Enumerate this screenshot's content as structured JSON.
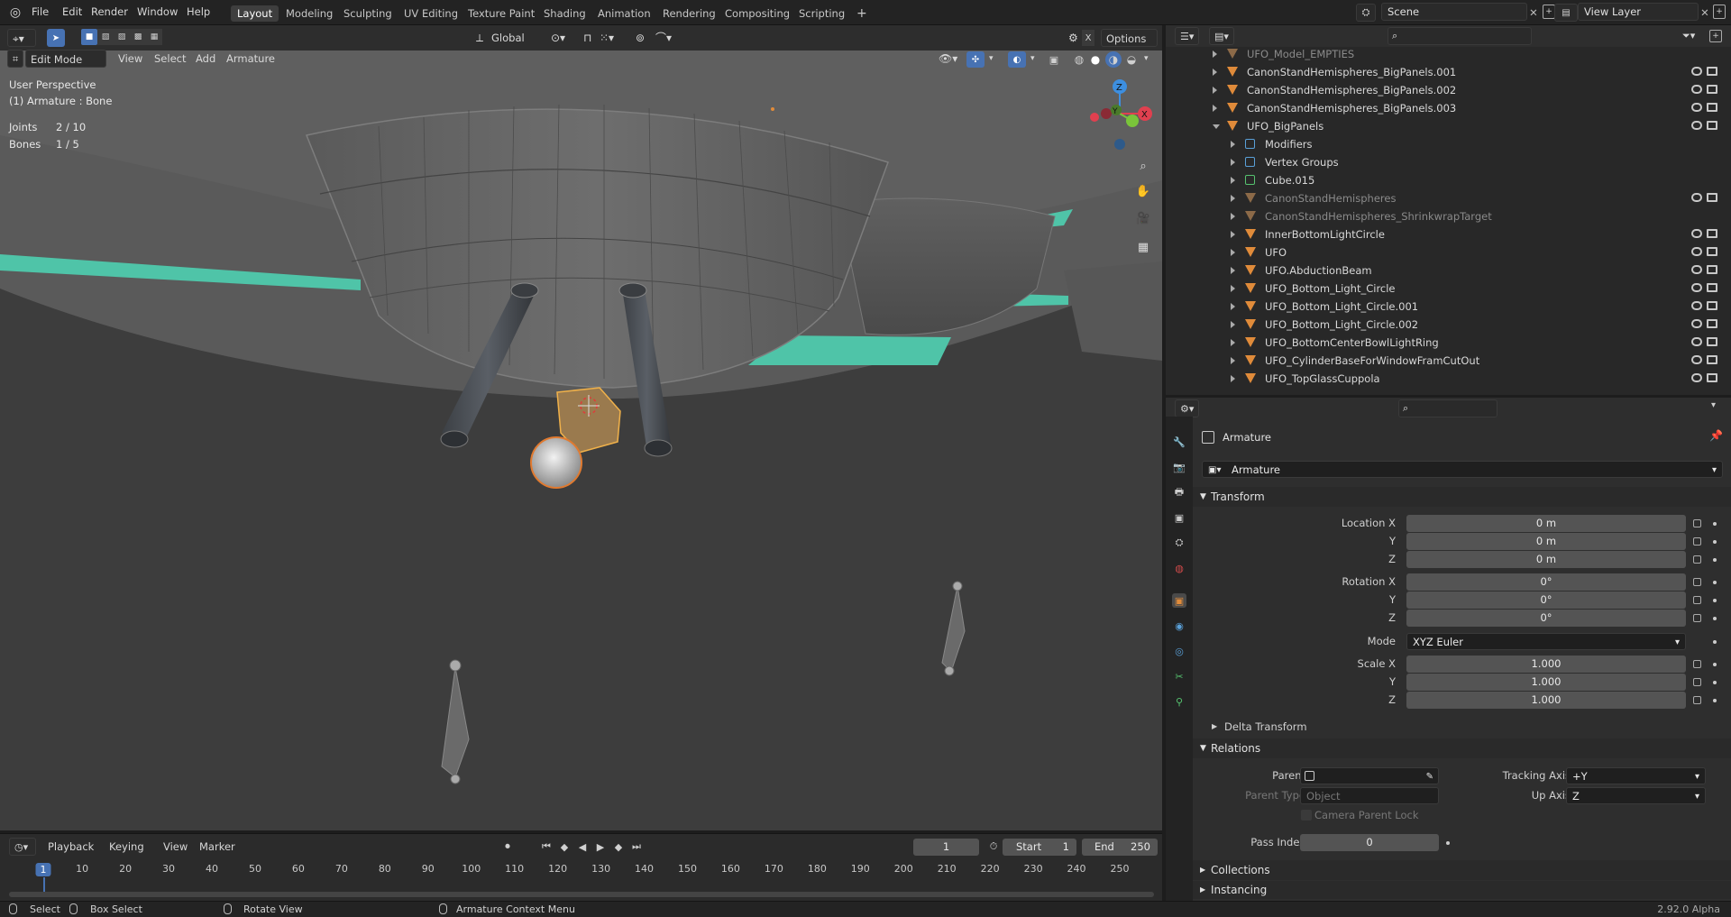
{
  "topbar": {
    "menus": [
      "File",
      "Edit",
      "Render",
      "Window",
      "Help"
    ],
    "workspaces": [
      "Layout",
      "Modeling",
      "Sculpting",
      "UV Editing",
      "Texture Paint",
      "Shading",
      "Animation",
      "Rendering",
      "Compositing",
      "Scripting"
    ],
    "active_workspace": "Layout",
    "add_tab": "+",
    "scene": "Scene",
    "view_layer": "View Layer"
  },
  "viewport_header": {
    "mode": "Edit Mode",
    "menus": [
      "View",
      "Select",
      "Add",
      "Armature"
    ],
    "orientation": "Global",
    "options": "Options"
  },
  "viewport": {
    "perspective": "User Perspective",
    "object_info": "(1) Armature : Bone",
    "stats": [
      {
        "label": "Joints",
        "value": "2 / 10"
      },
      {
        "label": "Bones",
        "value": "1 / 5"
      }
    ],
    "gizmo": {
      "x": "X",
      "y": "Y",
      "z": "Z"
    }
  },
  "timeline": {
    "menus": [
      "Playback",
      "Keying",
      "View",
      "Marker"
    ],
    "current_frame": "1",
    "start_label": "Start",
    "start": "1",
    "end_label": "End",
    "end": "250",
    "ticks": [
      "1",
      "10",
      "20",
      "30",
      "40",
      "50",
      "60",
      "70",
      "80",
      "90",
      "100",
      "110",
      "120",
      "130",
      "140",
      "150",
      "160",
      "170",
      "180",
      "190",
      "200",
      "210",
      "220",
      "230",
      "240",
      "250"
    ]
  },
  "status": {
    "select": "Select",
    "box_select": "Box Select",
    "rotate_view": "Rotate View",
    "context_menu": "Armature Context Menu",
    "version": "2.92.0 Alpha"
  },
  "outliner": {
    "rows": [
      {
        "name": "UFO_Model_EMPTIES",
        "indent": 0,
        "dim": true,
        "open": false,
        "vis": false
      },
      {
        "name": "CanonStandHemispheres_BigPanels.001",
        "indent": 0,
        "dim": false,
        "open": false,
        "vis": true
      },
      {
        "name": "CanonStandHemispheres_BigPanels.002",
        "indent": 0,
        "dim": false,
        "open": false,
        "vis": true
      },
      {
        "name": "CanonStandHemispheres_BigPanels.003",
        "indent": 0,
        "dim": false,
        "open": false,
        "vis": true
      },
      {
        "name": "UFO_BigPanels",
        "indent": 0,
        "dim": false,
        "open": true,
        "vis": true
      },
      {
        "name": "Modifiers",
        "indent": 1,
        "dim": false,
        "open": false,
        "vis": false
      },
      {
        "name": "Vertex Groups",
        "indent": 1,
        "dim": false,
        "open": false,
        "vis": false
      },
      {
        "name": "Cube.015",
        "indent": 1,
        "dim": false,
        "open": false,
        "vis": false
      },
      {
        "name": "CanonStandHemispheres",
        "indent": 1,
        "dim": true,
        "open": false,
        "vis": true
      },
      {
        "name": "CanonStandHemispheres_ShrinkwrapTarget",
        "indent": 1,
        "dim": true,
        "open": false,
        "vis": false
      },
      {
        "name": "InnerBottomLightCircle",
        "indent": 1,
        "dim": false,
        "open": false,
        "vis": true
      },
      {
        "name": "UFO",
        "indent": 1,
        "dim": false,
        "open": false,
        "vis": true
      },
      {
        "name": "UFO.AbductionBeam",
        "indent": 1,
        "dim": false,
        "open": false,
        "vis": true
      },
      {
        "name": "UFO_Bottom_Light_Circle",
        "indent": 1,
        "dim": false,
        "open": false,
        "vis": true
      },
      {
        "name": "UFO_Bottom_Light_Circle.001",
        "indent": 1,
        "dim": false,
        "open": false,
        "vis": true
      },
      {
        "name": "UFO_Bottom_Light_Circle.002",
        "indent": 1,
        "dim": false,
        "open": false,
        "vis": true
      },
      {
        "name": "UFO_BottomCenterBowlLightRing",
        "indent": 1,
        "dim": false,
        "open": false,
        "vis": true
      },
      {
        "name": "UFO_CylinderBaseForWindowFramCutOut",
        "indent": 1,
        "dim": false,
        "open": false,
        "vis": true
      },
      {
        "name": "UFO_TopGlassCuppola",
        "indent": 1,
        "dim": false,
        "open": false,
        "vis": true
      }
    ]
  },
  "properties": {
    "object_name": "Armature",
    "datablock": "Armature",
    "transform_title": "Transform",
    "location_x_label": "Location X",
    "location": [
      "0 m",
      "0 m",
      "0 m"
    ],
    "rotation_x_label": "Rotation X",
    "rotation": [
      "0°",
      "0°",
      "0°"
    ],
    "y_label": "Y",
    "z_label": "Z",
    "mode_label": "Mode",
    "mode": "XYZ Euler",
    "scale_x_label": "Scale X",
    "scale": [
      "1.000",
      "1.000",
      "1.000"
    ],
    "delta_transform": "Delta Transform",
    "relations_title": "Relations",
    "parent_label": "Parent",
    "parent_type_label": "Parent Type",
    "parent_type": "Object",
    "camera_parent_lock": "Camera Parent Lock",
    "tracking_axis_label": "Tracking Axis",
    "tracking_axis": "+Y",
    "up_axis_label": "Up Axis",
    "up_axis": "Z",
    "pass_index_label": "Pass Index",
    "pass_index": "0",
    "collections": "Collections",
    "instancing": "Instancing"
  },
  "colors": {
    "accent": "#4772b3",
    "selection": "#e08b3a",
    "teal_panel": "#4fc4a8"
  }
}
